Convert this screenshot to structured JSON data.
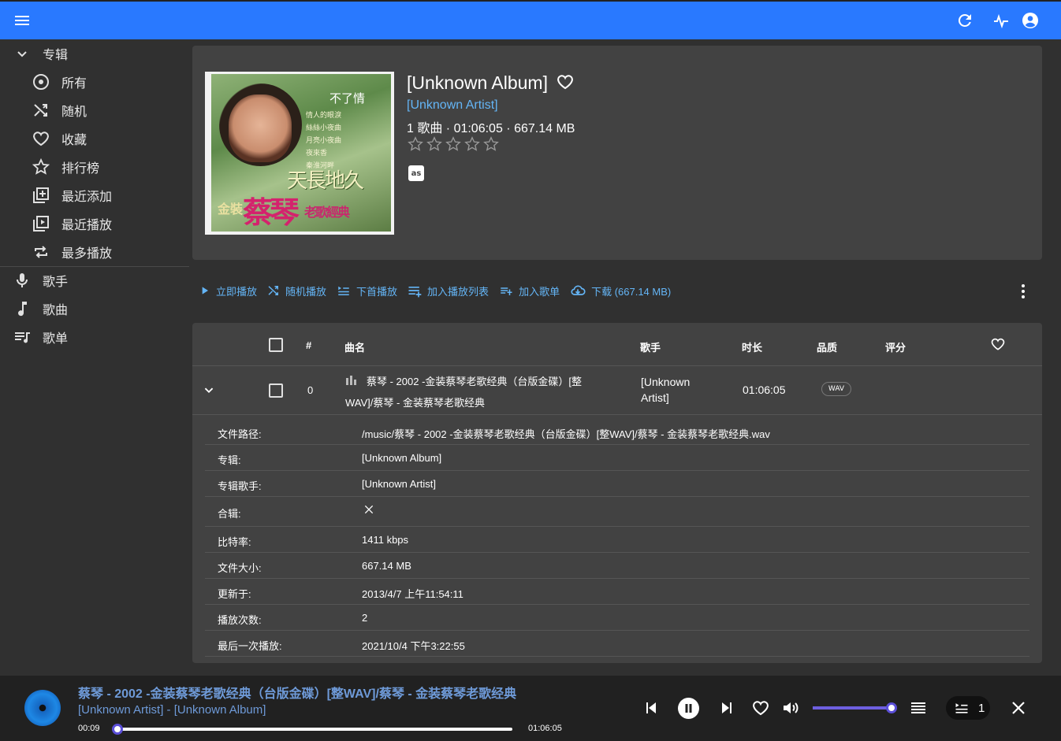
{
  "appbar": {
    "menu_icon": "menu-icon",
    "refresh_icon": "refresh-icon",
    "activity_icon": "activity-icon",
    "account_icon": "account-icon",
    "color": "#2979ff"
  },
  "sidebar": {
    "albums_label": "专辑",
    "album_items": [
      {
        "label": "所有",
        "icon": "album-icon"
      },
      {
        "label": "随机",
        "icon": "shuffle-icon"
      },
      {
        "label": "收藏",
        "icon": "heart-icon"
      },
      {
        "label": "排行榜",
        "icon": "star-icon"
      },
      {
        "label": "最近添加",
        "icon": "library-add-icon"
      },
      {
        "label": "最近播放",
        "icon": "video-library-icon"
      },
      {
        "label": "最多播放",
        "icon": "repeat-icon"
      }
    ],
    "artists_label": "歌手",
    "songs_label": "歌曲",
    "playlists_label": "歌单"
  },
  "album": {
    "title": "[Unknown Album]",
    "artist": "[Unknown Artist]",
    "meta": "1 歌曲 · 01:06:05 · 667.14 MB",
    "rating": 0,
    "lastfm_label": "as",
    "cover_text": {
      "top": "不了情",
      "lines": [
        "情人的眼淚",
        "絲絲小夜曲",
        "月亮小夜曲",
        "夜來香",
        "秦淮河畔"
      ],
      "mid": "天長地久",
      "big": "蔡琴",
      "side": "金裝",
      "sub": "老歌經典"
    }
  },
  "toolbar": {
    "play_now": "立即播放",
    "shuffle": "随机播放",
    "play_next": "下首播放",
    "add_queue": "加入播放列表",
    "add_playlist": "加入歌单",
    "download": "下载 (667.14 MB)"
  },
  "table": {
    "headers": {
      "num": "#",
      "title": "曲名",
      "artist": "歌手",
      "duration": "时长",
      "quality": "品质",
      "rating": "评分"
    },
    "row": {
      "num": "0",
      "title_line1": "蔡琴 - 2002 -金装蔡琴老歌经典（台版金碟）[整",
      "title_line2": "WAV]/蔡琴 - 金装蔡琴老歌经典",
      "artist_line1": "[Unknown",
      "artist_line2": "Artist]",
      "duration": "01:06:05",
      "quality": "WAV"
    },
    "details": [
      {
        "key": "文件路径:",
        "value": "/music/蔡琴 - 2002 -金装蔡琴老歌经典（台版金碟）[整WAV]/蔡琴 - 金装蔡琴老歌经典.wav"
      },
      {
        "key": "专辑:",
        "value": "[Unknown Album]"
      },
      {
        "key": "专辑歌手:",
        "value": "[Unknown Artist]"
      },
      {
        "key": "合辑:",
        "value": ""
      },
      {
        "key": "比特率:",
        "value": "1411 kbps"
      },
      {
        "key": "文件大小:",
        "value": "667.14 MB"
      },
      {
        "key": "更新于:",
        "value": "2013/4/7 上午11:54:11"
      },
      {
        "key": "播放次数:",
        "value": "2"
      },
      {
        "key": "最后一次播放:",
        "value": "2021/10/4 下午3:22:55"
      }
    ]
  },
  "player": {
    "title": "蔡琴 - 2002 -金装蔡琴老歌经典（台版金碟）[整WAV]/蔡琴 - 金装蔡琴老歌经典",
    "subtitle": "[Unknown Artist] - [Unknown Album]",
    "elapsed": "00:09",
    "total": "01:06:05",
    "progress_fraction": 0.0023,
    "volume_fraction": 1.0,
    "queue_count": "1",
    "accent": "#6e5fe0"
  }
}
